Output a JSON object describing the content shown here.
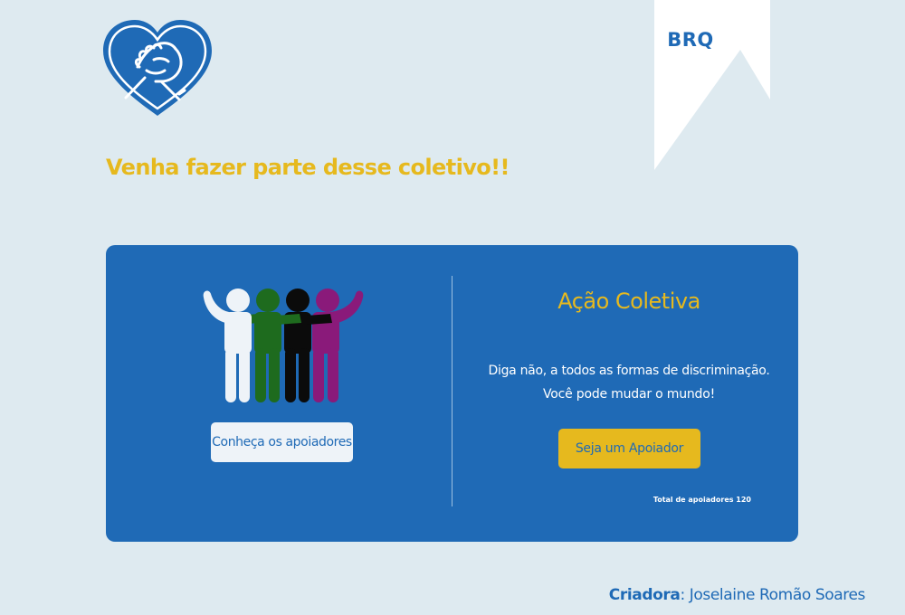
{
  "header": {
    "logo_icon": "heart-handshake-icon",
    "badge": "BRQ"
  },
  "headline": "Venha fazer parte desse coletivo!!",
  "card": {
    "illustration_icon": "people-group-icon",
    "supporters_button": "Conheça os apoiadores",
    "title": "Ação Coletiva",
    "description_line1": "Diga não, a todos as formas de discriminação.",
    "description_line2": "Você pode mudar o mundo!",
    "cta_button": "Seja um Apoiador",
    "total": "Total de apoiadores 120"
  },
  "footer": {
    "creator_label": "Criadora",
    "creator_name": ": Joselaine Romão Soares"
  },
  "colors": {
    "background": "#deeaf0",
    "primary_blue": "#1f6ab6",
    "accent_yellow": "#e6b91e",
    "person_white": "#eef3f8",
    "person_green": "#1e6b1e",
    "person_black": "#0b0b0b",
    "person_purple": "#8a1a7a"
  }
}
